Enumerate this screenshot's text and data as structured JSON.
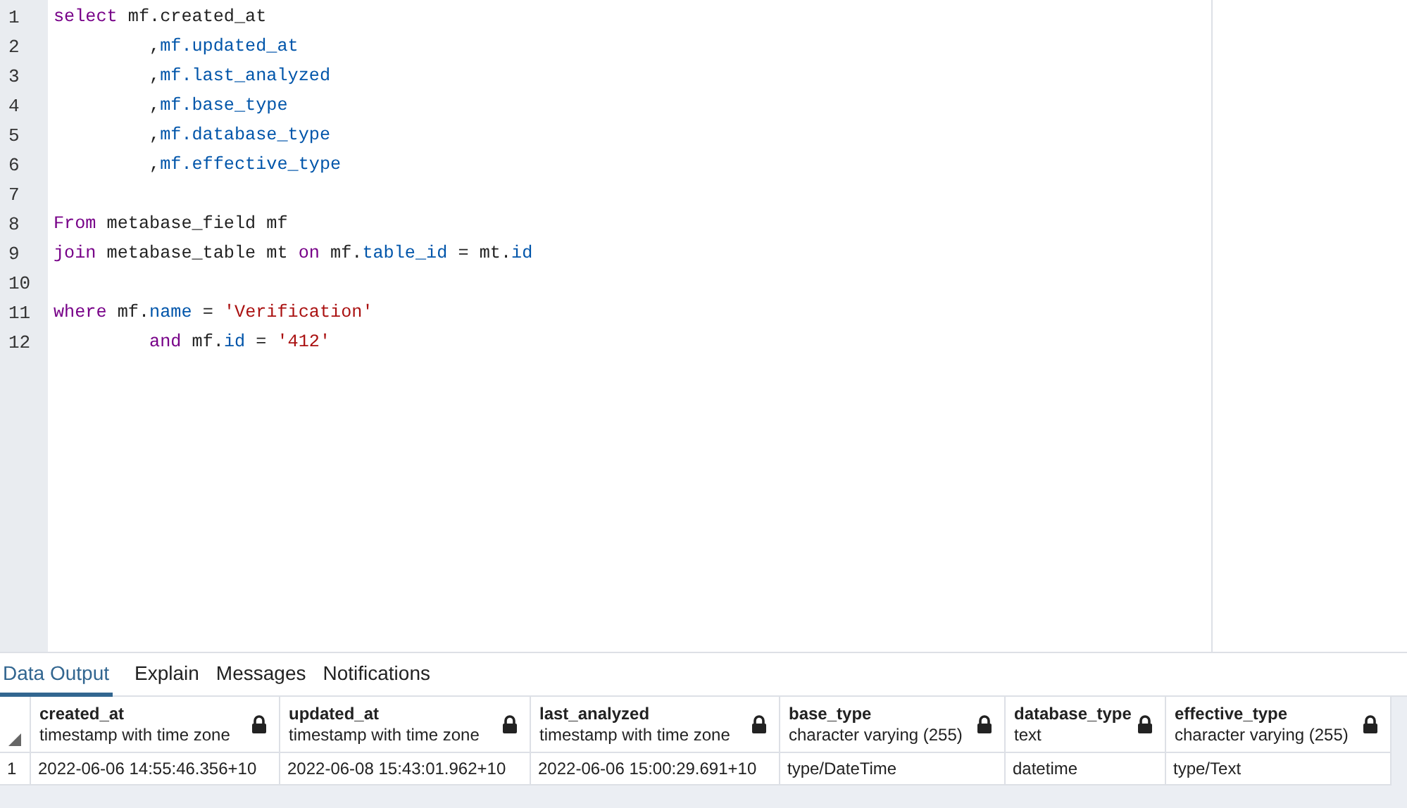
{
  "editor": {
    "lines": [
      {
        "number": "1",
        "tokens": [
          {
            "kind": "kw",
            "text": "select"
          },
          {
            "kind": "plain",
            "text": " mf.created_at"
          }
        ]
      },
      {
        "number": "2",
        "tokens": [
          {
            "kind": "plain",
            "text": "         ,"
          },
          {
            "kind": "ident",
            "text": "mf.updated_at"
          }
        ]
      },
      {
        "number": "3",
        "tokens": [
          {
            "kind": "plain",
            "text": "         ,"
          },
          {
            "kind": "ident",
            "text": "mf.last_analyzed"
          }
        ]
      },
      {
        "number": "4",
        "tokens": [
          {
            "kind": "plain",
            "text": "         ,"
          },
          {
            "kind": "ident",
            "text": "mf.base_type"
          }
        ]
      },
      {
        "number": "5",
        "tokens": [
          {
            "kind": "plain",
            "text": "         ,"
          },
          {
            "kind": "ident",
            "text": "mf.database_type"
          }
        ]
      },
      {
        "number": "6",
        "tokens": [
          {
            "kind": "plain",
            "text": "         ,"
          },
          {
            "kind": "ident",
            "text": "mf.effective_type"
          }
        ]
      },
      {
        "number": "7"
      },
      {
        "number": "8",
        "tokens": [
          {
            "kind": "kw",
            "text": "From"
          },
          {
            "kind": "plain",
            "text": " metabase_field mf"
          }
        ]
      },
      {
        "number": "9",
        "tokens": [
          {
            "kind": "kw",
            "text": "join"
          },
          {
            "kind": "plain",
            "text": " metabase_table mt "
          },
          {
            "kind": "kw",
            "text": "on"
          },
          {
            "kind": "plain",
            "text": " mf."
          },
          {
            "kind": "ident",
            "text": "table_id"
          },
          {
            "kind": "plain",
            "text": " = mt."
          },
          {
            "kind": "ident",
            "text": "id"
          }
        ]
      },
      {
        "number": "10"
      },
      {
        "number": "11",
        "tokens": [
          {
            "kind": "kw",
            "text": "where"
          },
          {
            "kind": "plain",
            "text": " mf."
          },
          {
            "kind": "ident",
            "text": "name"
          },
          {
            "kind": "plain",
            "text": " = "
          },
          {
            "kind": "str",
            "text": "'Verification'"
          }
        ]
      },
      {
        "number": "12",
        "tokens": [
          {
            "kind": "kw",
            "text": "         and"
          },
          {
            "kind": "plain",
            "text": " mf."
          },
          {
            "kind": "ident",
            "text": "id"
          },
          {
            "kind": "plain",
            "text": " = "
          },
          {
            "kind": "str",
            "text": "'412'"
          }
        ]
      }
    ]
  },
  "tabs": [
    {
      "label": "Data Output",
      "selected": true
    },
    {
      "label": "Explain",
      "selected": false
    },
    {
      "label": "Messages",
      "selected": false
    },
    {
      "label": "Notifications",
      "selected": false
    }
  ],
  "table": {
    "columns": [
      {
        "name": "created_at",
        "type": "timestamp with time zone",
        "locked": true
      },
      {
        "name": "updated_at",
        "type": "timestamp with time zone",
        "locked": true
      },
      {
        "name": "last_analyzed",
        "type": "timestamp with time zone",
        "locked": true
      },
      {
        "name": "base_type",
        "type": "character varying (255)",
        "locked": true
      },
      {
        "name": "database_type",
        "type": "text",
        "locked": true
      },
      {
        "name": "effective_type",
        "type": "character varying (255)",
        "locked": true
      }
    ],
    "rows": [
      {
        "number": "1",
        "cells": [
          "2022-06-06 14:55:46.356+10",
          "2022-06-08 15:43:01.962+10",
          "2022-06-06 15:00:29.691+10",
          "type/DateTime",
          "datetime",
          "type/Text"
        ]
      }
    ]
  }
}
